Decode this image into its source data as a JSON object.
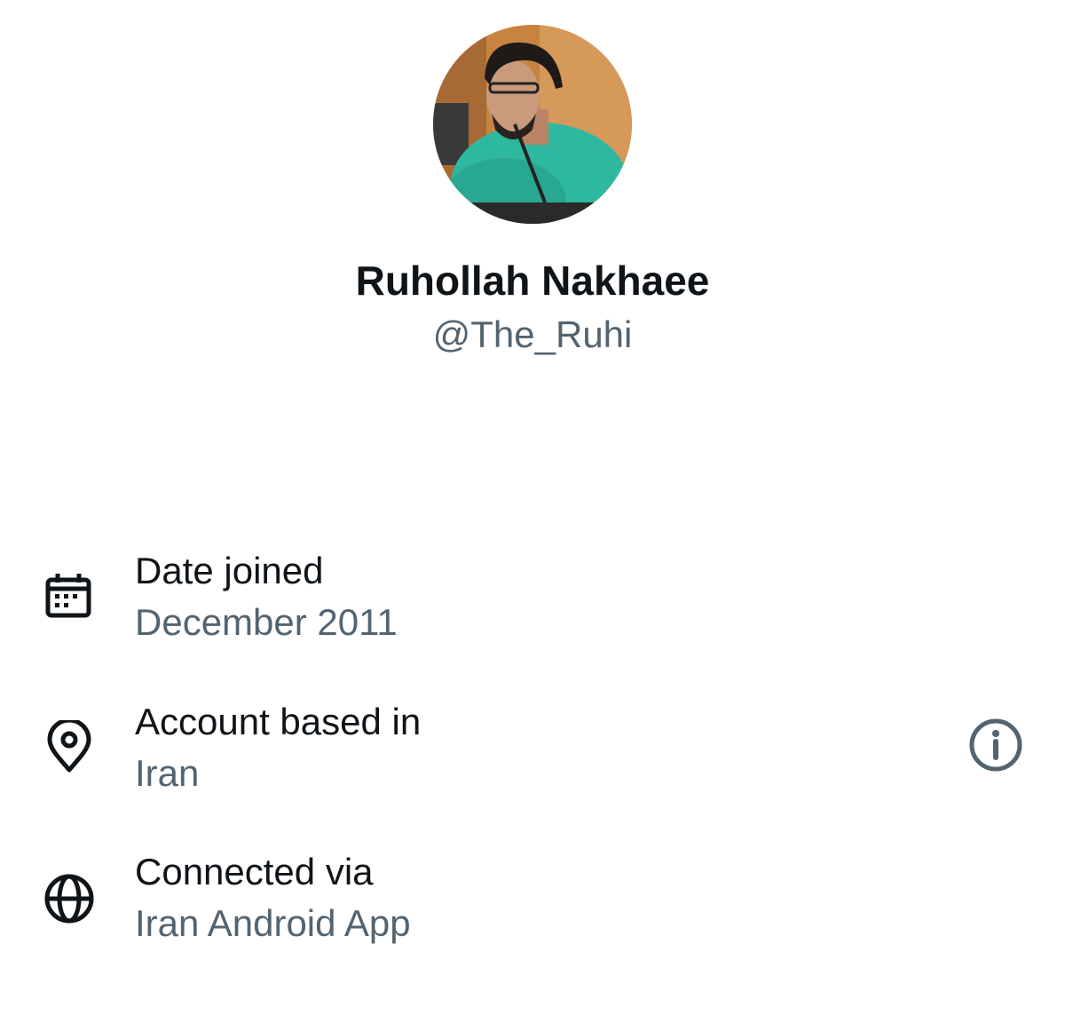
{
  "profile": {
    "display_name": "Ruhollah Nakhaee",
    "handle": "@The_Ruhi",
    "avatar_icon": "profile-photo"
  },
  "about": [
    {
      "icon": "calendar-icon",
      "label": "Date joined",
      "value": "December 2011"
    },
    {
      "icon": "location-pin-icon",
      "label": "Account based in",
      "value": "Iran",
      "has_info": true
    },
    {
      "icon": "globe-icon",
      "label": "Connected via",
      "value": "Iran Android App"
    }
  ],
  "colors": {
    "primary_text": "#0f1419",
    "secondary_text": "#536471",
    "background": "#ffffff"
  }
}
